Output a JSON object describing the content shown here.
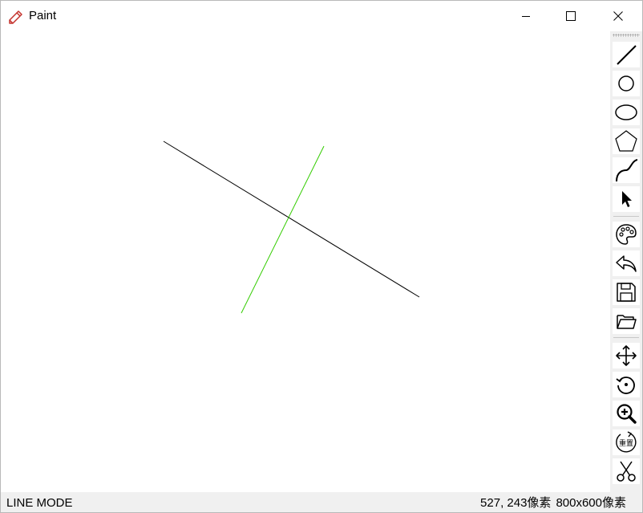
{
  "window": {
    "title": "Paint",
    "app_icon": "pencil-icon",
    "accent_color": "#c4312c"
  },
  "toolbar": {
    "tools": [
      {
        "name": "line-tool-button",
        "icon": "line-icon"
      },
      {
        "name": "circle-tool-button",
        "icon": "circle-icon"
      },
      {
        "name": "ellipse-tool-button",
        "icon": "ellipse-icon"
      },
      {
        "name": "polygon-tool-button",
        "icon": "pentagon-icon"
      },
      {
        "name": "curve-tool-button",
        "icon": "curve-icon"
      },
      {
        "name": "select-tool-button",
        "icon": "cursor-arrow-icon"
      },
      {
        "name": "color-palette-button",
        "icon": "palette-icon"
      },
      {
        "name": "undo-button",
        "icon": "undo-arrow-icon"
      },
      {
        "name": "save-button",
        "icon": "floppy-disk-icon"
      },
      {
        "name": "open-file-button",
        "icon": "folder-open-icon"
      },
      {
        "name": "move-button",
        "icon": "move-arrows-icon"
      },
      {
        "name": "rotate-button",
        "icon": "rotate-icon"
      },
      {
        "name": "zoom-button",
        "icon": "zoom-in-icon"
      },
      {
        "name": "reset-button",
        "icon": "reset-icon",
        "label": "重置"
      },
      {
        "name": "clip-button",
        "icon": "scissors-icon"
      }
    ]
  },
  "canvas": {
    "shapes": [
      {
        "type": "line",
        "color": "#000000"
      },
      {
        "type": "line",
        "color": "#33cc00"
      }
    ]
  },
  "status": {
    "mode": "LINE MODE",
    "cursor_position": "527, 243像素",
    "canvas_size": "800x600像素"
  }
}
